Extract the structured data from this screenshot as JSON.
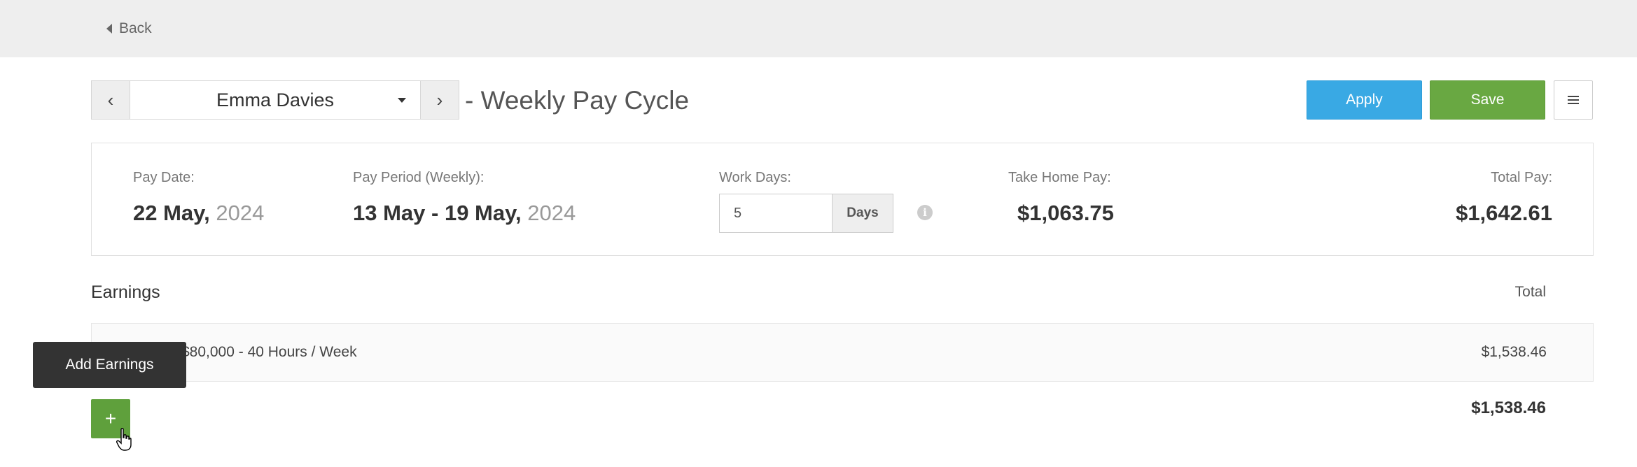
{
  "header": {
    "back_label": "Back"
  },
  "employee": {
    "name": "Emma Davies",
    "prev_symbol": "‹",
    "next_symbol": "›"
  },
  "cycle_title": "- Weekly Pay Cycle",
  "actions": {
    "apply_label": "Apply",
    "save_label": "Save"
  },
  "summary": {
    "pay_date_label": "Pay Date:",
    "pay_date_main": "22 May,",
    "pay_date_year": "2024",
    "pay_period_label": "Pay Period (Weekly):",
    "pay_period_main": "13 May - 19 May,",
    "pay_period_year": "2024",
    "work_days_label": "Work Days:",
    "work_days_value": "5",
    "work_days_unit": "Days",
    "take_home_label": "Take Home Pay:",
    "take_home_value": "$1,063.75",
    "total_pay_label": "Total Pay:",
    "total_pay_value": "$1,642.61"
  },
  "earnings": {
    "title": "Earnings",
    "total_header": "Total",
    "rows": [
      {
        "description": "$80,000 - 40 Hours / Week",
        "amount": "$1,538.46"
      }
    ],
    "sum": "$1,538.46",
    "add_tooltip": "Add Earnings",
    "add_symbol": "+"
  },
  "colors": {
    "apply": "#39a9e4",
    "save": "#69a842",
    "add": "#5fa03c"
  }
}
